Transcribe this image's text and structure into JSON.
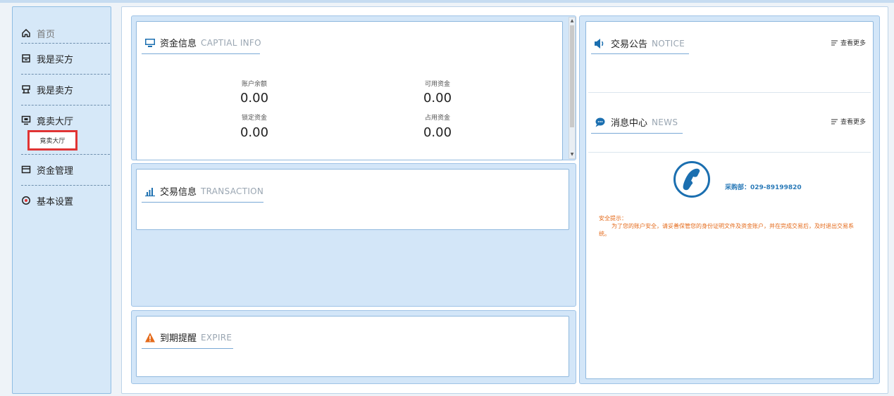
{
  "sidebar": {
    "items": [
      {
        "label": "首页",
        "icon": "home-icon"
      },
      {
        "label": "我是买方",
        "icon": "buyer-icon"
      },
      {
        "label": "我是卖方",
        "icon": "seller-icon"
      },
      {
        "label": "竟卖大厅",
        "icon": "auction-hall-icon"
      },
      {
        "label": "资金管理",
        "icon": "fund-management-icon"
      },
      {
        "label": "基本设置",
        "icon": "settings-icon"
      }
    ],
    "sub_item": "竟卖大厅"
  },
  "capital": {
    "title_cn": "资金信息",
    "title_en": "CAPTIAL INFO",
    "account_balance_label": "账户余额",
    "account_balance_value": "0.00",
    "available_funds_label": "可用资金",
    "available_funds_value": "0.00",
    "locked_funds_label": "锁定资金",
    "locked_funds_value": "0.00",
    "occupied_funds_label": "占用资金",
    "occupied_funds_value": "0.00"
  },
  "transaction": {
    "title_cn": "交易信息",
    "title_en": "TRANSACTION"
  },
  "expire": {
    "title_cn": "到期提醒",
    "title_en": "EXPIRE"
  },
  "notice": {
    "title_cn": "交易公告",
    "title_en": "NOTICE",
    "more": "查看更多"
  },
  "news": {
    "title_cn": "消息中心",
    "title_en": "NEWS",
    "more": "查看更多"
  },
  "contact": {
    "dept": "采购部：029-89199820",
    "safety_title": "安全提示：",
    "safety_text": "为了您的账户安全，请妥善保管您的身份证明文件及资金账户，并在完成交易后，及时退出交易系统。"
  },
  "colors": {
    "accent": "#1b6fb0",
    "warning": "#e46a1a",
    "highlight": "#e03434"
  }
}
